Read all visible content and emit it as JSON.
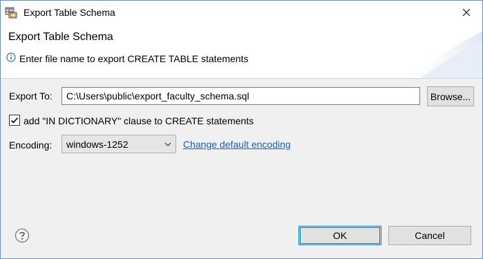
{
  "window": {
    "title": "Export Table Schema",
    "icons": {
      "app": "table-export-app-icon",
      "close": "close-icon"
    }
  },
  "banner": {
    "title": "Export Table Schema",
    "message": "Enter file name to export CREATE TABLE statements",
    "icon": "info-icon"
  },
  "form": {
    "export_to_label": "Export To:",
    "export_path": "C:\\Users\\public\\export_faculty_schema.sql",
    "browse_label": "Browse...",
    "in_dictionary_label": "add \"IN DICTIONARY\" clause to CREATE statements",
    "in_dictionary_checked": true,
    "encoding_label": "Encoding:",
    "encoding_value": "windows-1252",
    "change_encoding_link": "Change default encoding"
  },
  "footer": {
    "ok_label": "OK",
    "cancel_label": "Cancel",
    "help_icon": "help-icon"
  },
  "colors": {
    "window_border": "#6b8ec8",
    "dialog_bg": "#f0f0f0",
    "link": "#1a5eb5",
    "default_button_border": "#0078d7"
  }
}
